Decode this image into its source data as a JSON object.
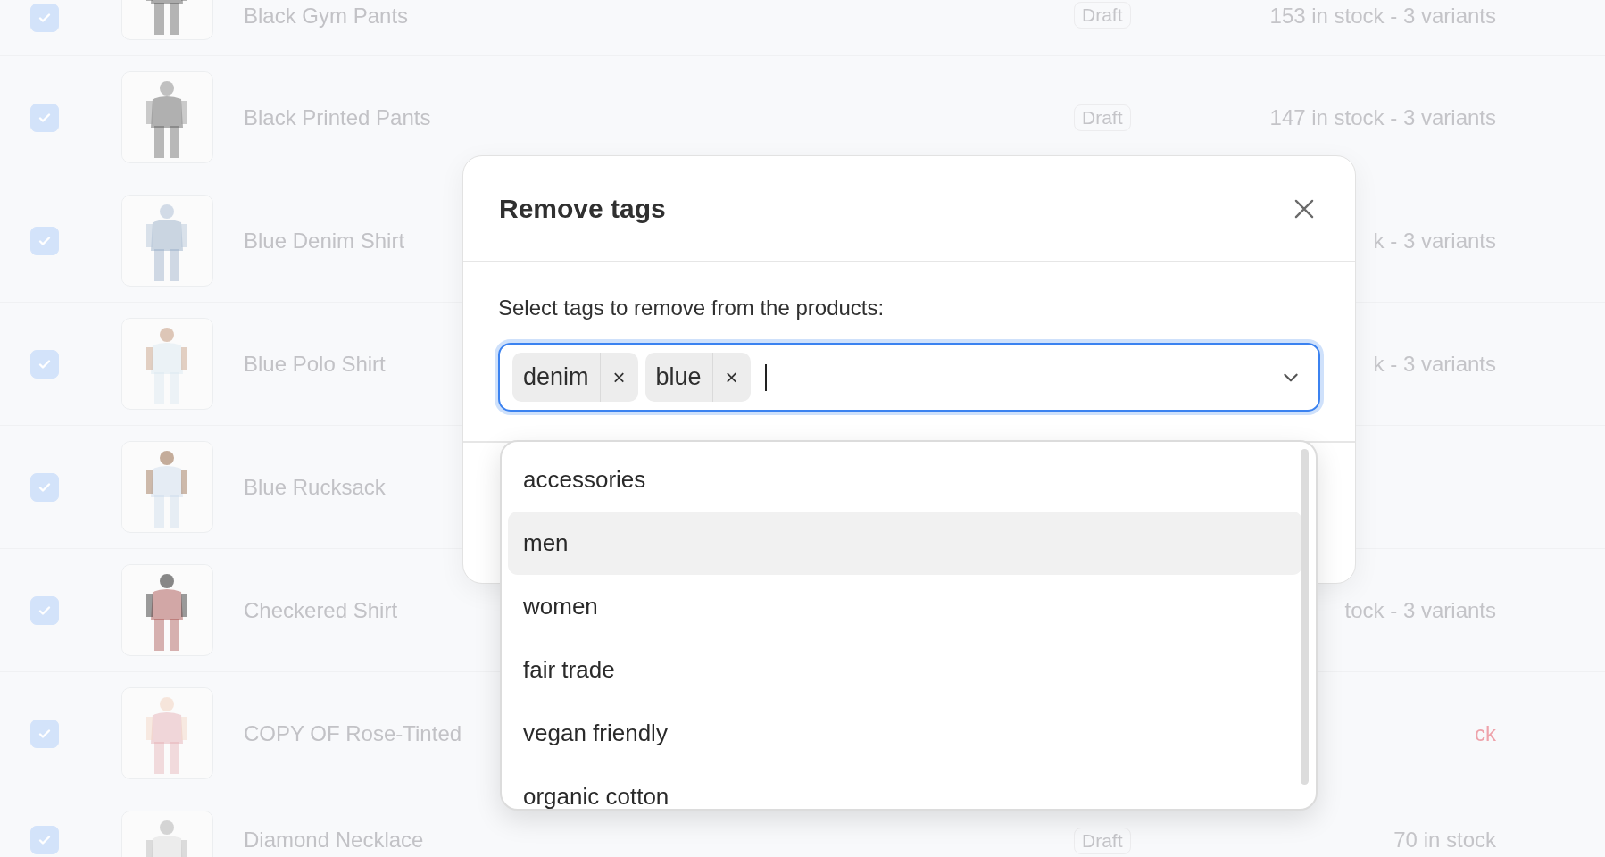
{
  "products": [
    {
      "name": "Black Gym Pants",
      "checked": true,
      "status": "Draft",
      "stock": "153 in stock - 3 variants",
      "stock_alert": false
    },
    {
      "name": "Black Printed Pants",
      "checked": true,
      "status": "Draft",
      "stock": "147 in stock - 3 variants",
      "stock_alert": false
    },
    {
      "name": "Blue Denim Shirt",
      "checked": true,
      "stock": "k - 3 variants",
      "stock_alert": false
    },
    {
      "name": "Blue Polo Shirt",
      "checked": true,
      "stock": "k - 3 variants",
      "stock_alert": false
    },
    {
      "name": "Blue Rucksack",
      "checked": true
    },
    {
      "name": "Checkered Shirt",
      "checked": true,
      "stock": "tock - 3 variants",
      "stock_alert": false
    },
    {
      "name": "COPY OF Rose-Tinted",
      "checked": true,
      "stock": "ck",
      "stock_alert": true
    },
    {
      "name": "Diamond Necklace",
      "checked": true,
      "status": "Draft",
      "stock": "70 in stock",
      "stock_alert": false
    }
  ],
  "dialog": {
    "title": "Remove tags",
    "label": "Select tags to remove from the products:",
    "tags": [
      {
        "label": "denim",
        "remove": "×"
      },
      {
        "label": "blue",
        "remove": "×"
      }
    ],
    "options": [
      {
        "label": "accessories",
        "selected": false
      },
      {
        "label": "men",
        "selected": true
      },
      {
        "label": "women",
        "selected": false
      },
      {
        "label": "fair trade",
        "selected": false
      },
      {
        "label": "vegan friendly",
        "selected": false
      },
      {
        "label": "organic cotton",
        "selected": false
      }
    ]
  }
}
